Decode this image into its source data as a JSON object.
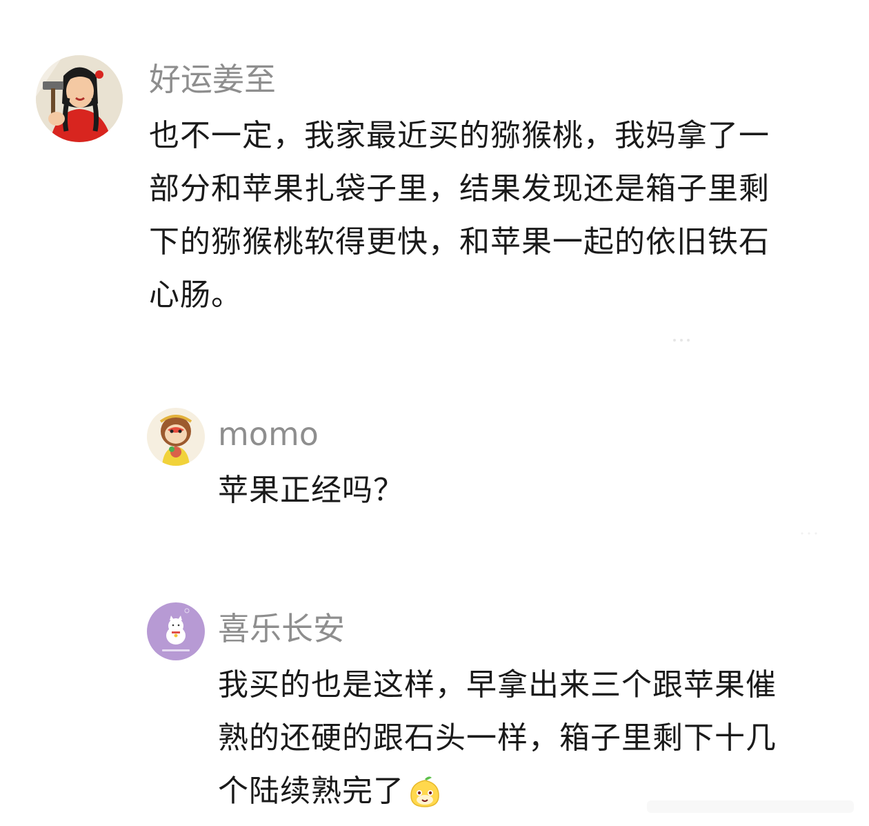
{
  "comments": [
    {
      "username": "好运姜至",
      "avatar": "revolutionary-poster-girl-avatar",
      "lines": [
        "也不一定，我家最近买的猕猴桃，我妈拿了一",
        "部分和苹果扎袋子里，结果发现还是箱子里剩",
        "下的猕猴桃软得更快，和苹果一起的依旧铁石",
        "心肠。"
      ]
    },
    {
      "username": "momo",
      "avatar": "monkey-king-avatar",
      "lines": [
        "苹果正经吗？"
      ]
    },
    {
      "username": "喜乐长安",
      "avatar": "lucky-cat-avatar",
      "lines": [
        "我买的也是这样，早拿出来三个跟苹果催",
        "熟的还硬的跟石头一样，箱子里剩下十几",
        "个陆续熟完了"
      ],
      "emoji": "smiling-mango-emoji"
    }
  ],
  "colors": {
    "username": "#8e8e8e",
    "text": "#1a1a1a",
    "background": "#ffffff"
  }
}
